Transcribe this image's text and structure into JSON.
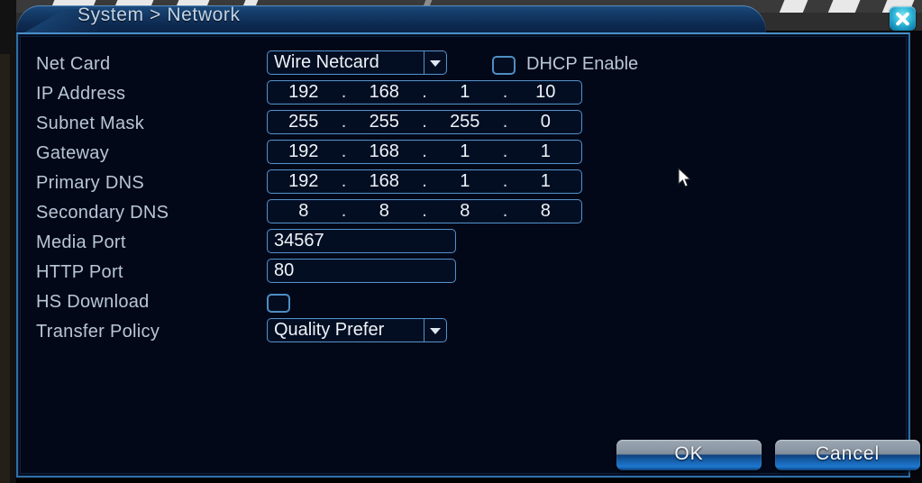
{
  "window": {
    "title": "System > Network",
    "close_icon": "close-icon"
  },
  "form": {
    "rows": [
      {
        "label": "Net Card",
        "type": "select",
        "value": "Wire Netcard"
      },
      {
        "label": "IP Address",
        "type": "ip",
        "octets": [
          "192",
          "168",
          "1",
          "10"
        ]
      },
      {
        "label": "Subnet Mask",
        "type": "ip",
        "octets": [
          "255",
          "255",
          "255",
          "0"
        ]
      },
      {
        "label": "Gateway",
        "type": "ip",
        "octets": [
          "192",
          "168",
          "1",
          "1"
        ]
      },
      {
        "label": "Primary DNS",
        "type": "ip",
        "octets": [
          "192",
          "168",
          "1",
          "1"
        ]
      },
      {
        "label": "Secondary DNS",
        "type": "ip",
        "octets": [
          "8",
          "8",
          "8",
          "8"
        ]
      },
      {
        "label": "Media Port",
        "type": "text",
        "value": "34567"
      },
      {
        "label": "HTTP Port",
        "type": "text",
        "value": "80"
      },
      {
        "label": "HS Download",
        "type": "checkbox",
        "checked": false
      },
      {
        "label": "Transfer Policy",
        "type": "select",
        "value": "Quality Prefer"
      }
    ],
    "dhcp": {
      "label": "DHCP Enable",
      "checked": false
    }
  },
  "labels": {
    "net_card": "Net Card",
    "ip_address": "IP Address",
    "subnet_mask": "Subnet Mask",
    "gateway": "Gateway",
    "primary_dns": "Primary DNS",
    "secondary_dns": "Secondary DNS",
    "media_port": "Media Port",
    "http_port": "HTTP Port",
    "hs_download": "HS Download",
    "transfer_policy": "Transfer Policy"
  },
  "values": {
    "net_card": "Wire Netcard",
    "ip_address": "192.168.1.10",
    "subnet_mask": "255.255.255.0",
    "gateway": "192.168.1.1",
    "primary_dns": "192.168.1.1",
    "secondary_dns": "8.8.8.8",
    "media_port": "34567",
    "http_port": "80",
    "transfer_policy": "Quality Prefer"
  },
  "buttons": {
    "ok": "OK",
    "cancel": "Cancel"
  },
  "colors": {
    "panel_bg": "#020818",
    "panel_border": "#2f6fa8",
    "field_border": "#5590c4",
    "label_text": "#b8c6d6",
    "value_text": "#eef3f8",
    "title_text": "#c3d4e6",
    "close_accent": "#2fb6d8",
    "button_accent": "#1d78cf"
  }
}
